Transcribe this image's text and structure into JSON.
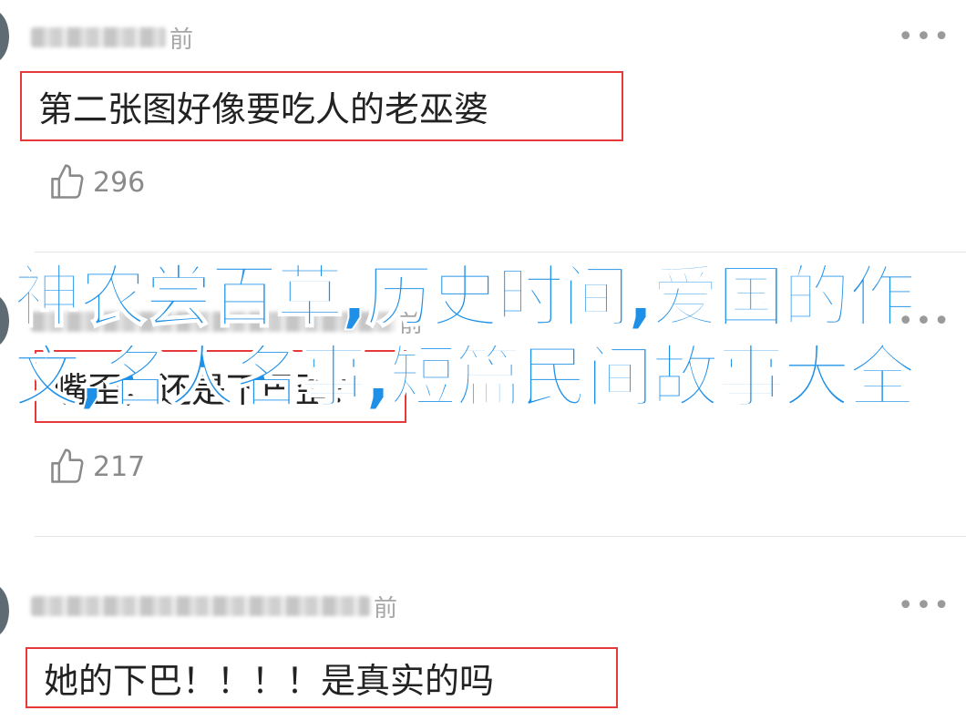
{
  "comments": [
    {
      "time_suffix": "前",
      "text": "第二张图好像要吃人的老巫婆",
      "likes": "296"
    },
    {
      "time_suffix": "前",
      "text": "嘴歪，还是下巴歪？",
      "likes": "217"
    },
    {
      "time_suffix": "前",
      "text": "她的下巴！！！！是真实的吗",
      "likes": ""
    }
  ],
  "more_label": "•••",
  "overlay_text": "神农尝百草,历史时间,爱国的作文,名人名事,短篇民间故事大全",
  "colors": {
    "overlay": "#1e90e8",
    "highlight_border": "#e63a3a"
  },
  "icons": {
    "like": "thumbs-up-icon",
    "more": "more-dots-icon"
  }
}
